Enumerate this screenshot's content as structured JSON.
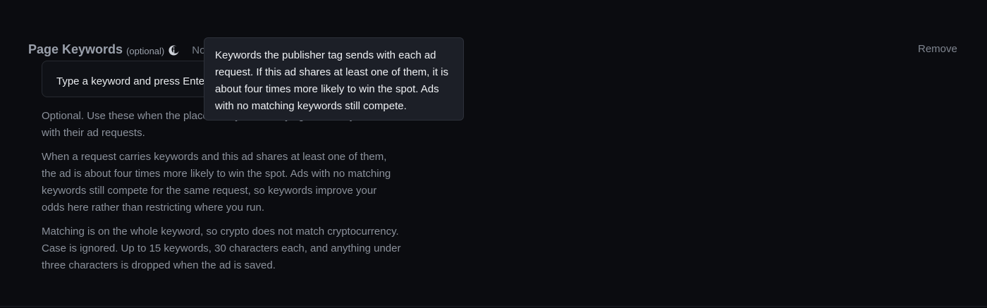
{
  "field": {
    "title": "Page Keywords",
    "optional_label": "(optional)",
    "status_text": "Not set",
    "remove_label": "Remove"
  },
  "input": {
    "placeholder": "Type a keyword and press Enter"
  },
  "help": {
    "paragraph_1": "Optional. Use these when the placement you are buying sends keywords with their ad requests.",
    "paragraph_2": "When a request carries keywords and this ad shares at least one of them, the ad is about four times more likely to win the spot. Ads with no matching keywords still compete for the same request, so keywords improve your odds here rather than restricting where you run.",
    "paragraph_3": "Matching is on the whole keyword, so crypto does not match cryptocurrency. Case is ignored. Up to 15 keywords, 30 characters each, and anything under three characters is dropped when the ad is saved."
  },
  "tooltip": {
    "text": "Keywords the publisher tag sends with each ad request. If this ad shares at least one of them, it is about four times more likely to win the spot. Ads with no matching keywords still compete."
  },
  "icons": {
    "info": "info-icon"
  },
  "colors": {
    "background": "#0b0c10",
    "tooltip_background": "#1c1f27",
    "muted_text": "#8b919b"
  }
}
